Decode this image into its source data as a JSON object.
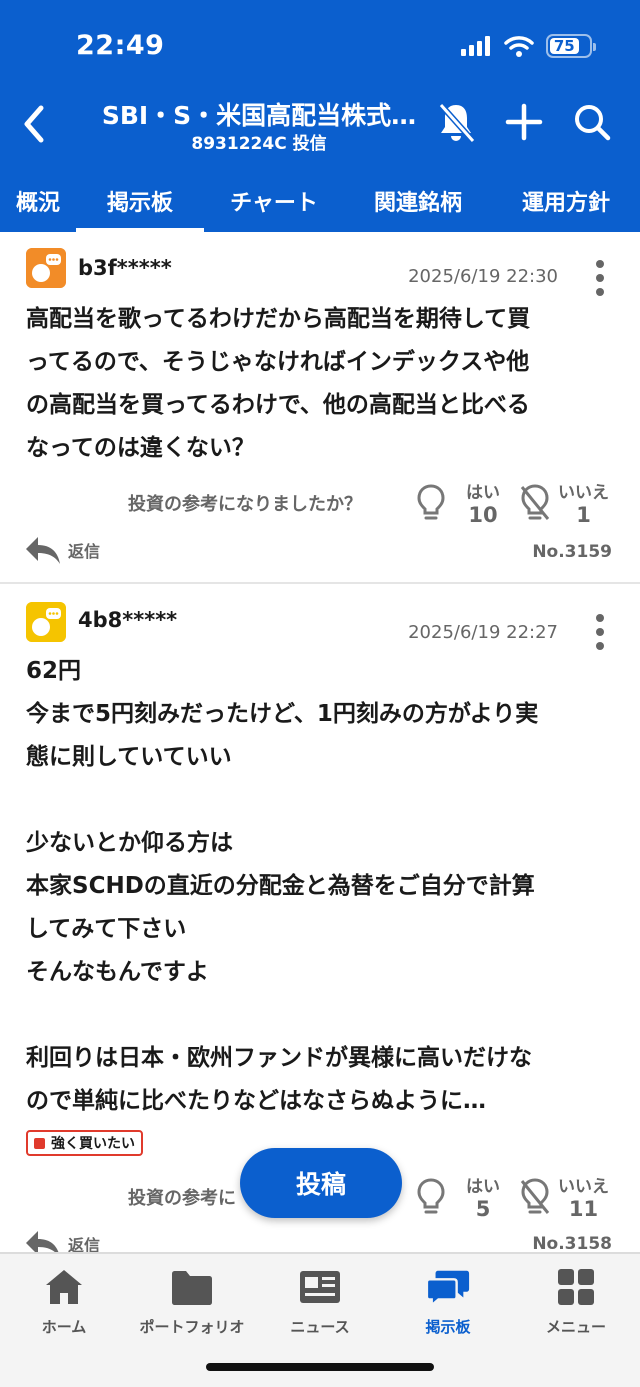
{
  "status": {
    "time": "22:49",
    "battery": "75"
  },
  "nav": {
    "title": "SBI・S・米国高配当株式…",
    "subtitle": "8931224C 投信"
  },
  "tabs": [
    {
      "label": "概況"
    },
    {
      "label": "掲示板"
    },
    {
      "label": "チャート"
    },
    {
      "label": "関連銘柄"
    },
    {
      "label": "運用方針"
    }
  ],
  "posts": [
    {
      "user": "b3f*****",
      "time": "2025/6/19 22:30",
      "lines": [
        "高配当を歌ってるわけだから高配当を期待して買",
        "ってるので、そうじゃなければインデックスや他",
        "の高配当を買ってるわけで、他の高配当と比べる",
        "なってのは違くない？"
      ],
      "question": "投資の参考になりましたか？",
      "yes_label": "はい",
      "yes_count": "10",
      "no_label": "いいえ",
      "no_count": "1",
      "reply": "返信",
      "number": "No.3159",
      "avatar_color": "#f28c28"
    },
    {
      "user": "4b8*****",
      "time": "2025/6/19 22:27",
      "lines": [
        "62円",
        "今まで5円刻みだったけど、1円刻みの方がより実",
        "態に則していていい",
        "",
        "少ないとか仰る方は",
        "本家SCHDの直近の分配金と為替をご自分で計算",
        "してみて下さい",
        "そんなもんですよ",
        "",
        "利回りは日本・欧州ファンドが異様に高いだけな",
        "ので単純に比べたりなどはなさらぬように…"
      ],
      "badge": "強く買いたい",
      "question": "投資の参考に",
      "yes_label": "はい",
      "yes_count": "5",
      "no_label": "いいえ",
      "no_count": "11",
      "reply": "返信",
      "number": "No.3158",
      "avatar_color": "#f5c400"
    }
  ],
  "fab": {
    "label": "投稿"
  },
  "bottom_nav": [
    {
      "label": "ホーム"
    },
    {
      "label": "ポートフォリオ"
    },
    {
      "label": "ニュース"
    },
    {
      "label": "掲示板"
    },
    {
      "label": "メニュー"
    }
  ],
  "colors": {
    "brand": "#0b5fce",
    "badge_red": "#e03a2c",
    "muted": "#666666"
  }
}
